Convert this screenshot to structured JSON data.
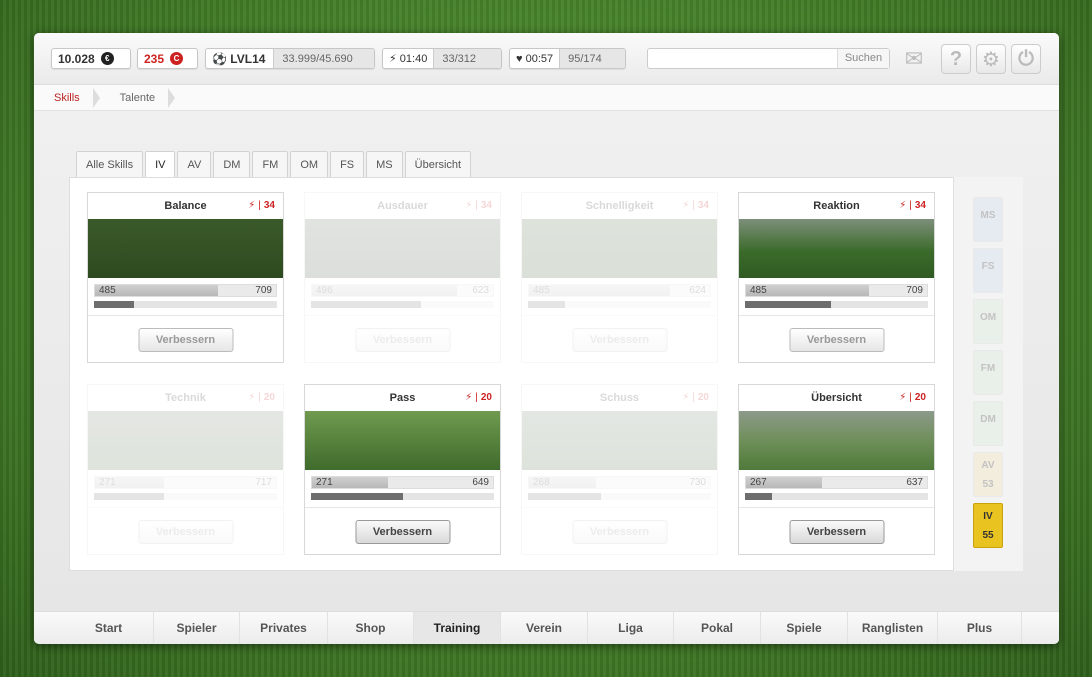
{
  "stats": {
    "money": "10.028",
    "money_icon": "€",
    "credits": "235",
    "credits_icon": "C",
    "level": "LVL14",
    "xp": "33.999/45.690",
    "energy_timer": "01:40",
    "energy": "33/312",
    "health_timer": "00:57",
    "health": "95/174"
  },
  "search": {
    "placeholder": "",
    "button": "Suchen"
  },
  "breadcrumb": [
    "Skills",
    "Talente"
  ],
  "tabs": [
    "Alle Skills",
    "IV",
    "AV",
    "DM",
    "FM",
    "OM",
    "FS",
    "MS",
    "Übersicht"
  ],
  "active_tab": "IV",
  "cards": [
    {
      "title": "Balance",
      "cost": "34",
      "value": "485",
      "max": "709",
      "progress": 0.68,
      "sub": 0.22,
      "button": "Verbessern",
      "state": "available"
    },
    {
      "title": "Ausdauer",
      "cost": "34",
      "value": "496",
      "max": "623",
      "progress": 0.8,
      "sub": 0.6,
      "button": "Verbessern",
      "state": "locked"
    },
    {
      "title": "Schnelligkeit",
      "cost": "34",
      "value": "485",
      "max": "624",
      "progress": 0.78,
      "sub": 0.2,
      "button": "Verbessern",
      "state": "locked"
    },
    {
      "title": "Reaktion",
      "cost": "34",
      "value": "485",
      "max": "709",
      "progress": 0.68,
      "sub": 0.47,
      "button": "Verbessern",
      "state": "available"
    },
    {
      "title": "Technik",
      "cost": "20",
      "value": "271",
      "max": "717",
      "progress": 0.38,
      "sub": 0.38,
      "button": "Verbessern",
      "state": "locked"
    },
    {
      "title": "Pass",
      "cost": "20",
      "value": "271",
      "max": "649",
      "progress": 0.42,
      "sub": 0.5,
      "button": "Verbessern",
      "state": "active"
    },
    {
      "title": "Schuss",
      "cost": "20",
      "value": "268",
      "max": "730",
      "progress": 0.37,
      "sub": 0.4,
      "button": "Verbessern",
      "state": "locked"
    },
    {
      "title": "Übersicht",
      "cost": "20",
      "value": "267",
      "max": "637",
      "progress": 0.42,
      "sub": 0.15,
      "button": "Verbessern",
      "state": "active"
    }
  ],
  "positions": [
    {
      "label": "MS",
      "value": "",
      "color": "#bcd6ee"
    },
    {
      "label": "FS",
      "value": "",
      "color": "#bcd6ee"
    },
    {
      "label": "OM",
      "value": "",
      "color": "#cfe6cc"
    },
    {
      "label": "FM",
      "value": "",
      "color": "#cfe6cc"
    },
    {
      "label": "DM",
      "value": "",
      "color": "#cfe6cc"
    },
    {
      "label": "AV",
      "value": "53",
      "color": "#f1dca0"
    },
    {
      "label": "IV",
      "value": "55",
      "color": "#e9c421"
    }
  ],
  "nav": [
    "Start",
    "Spieler",
    "Privates",
    "Shop",
    "Training",
    "Verein",
    "Liga",
    "Pokal",
    "Spiele",
    "Ranglisten",
    "Plus"
  ],
  "active_nav": "Training"
}
